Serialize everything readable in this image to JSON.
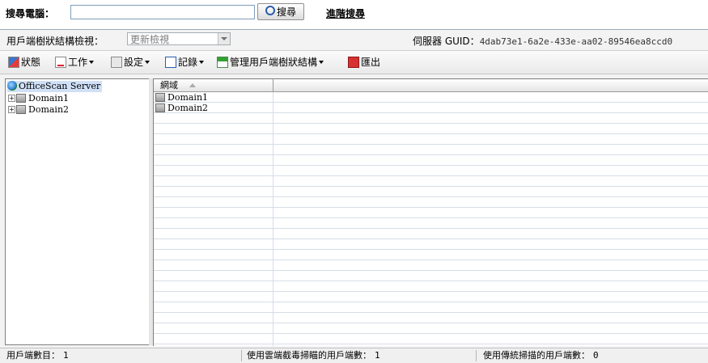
{
  "search": {
    "label": "搜尋電腦：",
    "value": "",
    "button_label": "搜尋",
    "advanced_link": "進階搜尋"
  },
  "view": {
    "label": "用戶端樹狀結構檢視：",
    "select_value": "更新檢視",
    "guid_label": "伺服器 GUID：",
    "guid_value": "4dab73e1-6a2e-433e-aa02-89546ea8ccd0"
  },
  "toolbar": {
    "status": "狀態",
    "tasks": "工作",
    "settings": "設定",
    "logs": "記錄",
    "manage": "管理用戶端樹狀結構",
    "export": "匯出"
  },
  "tree": {
    "root": "OfficeScan Server",
    "domains": [
      "Domain1",
      "Domain2"
    ]
  },
  "grid": {
    "column_header": "網域",
    "rows": [
      "Domain1",
      "Domain2"
    ]
  },
  "status": {
    "clients_label": "用戶端數目：",
    "clients_value": "1",
    "cloud_label": "使用雲端截毒掃瞄的用戶端數：",
    "cloud_value": "1",
    "traditional_label": "使用傳統掃描的用戶端數：",
    "traditional_value": "0"
  }
}
